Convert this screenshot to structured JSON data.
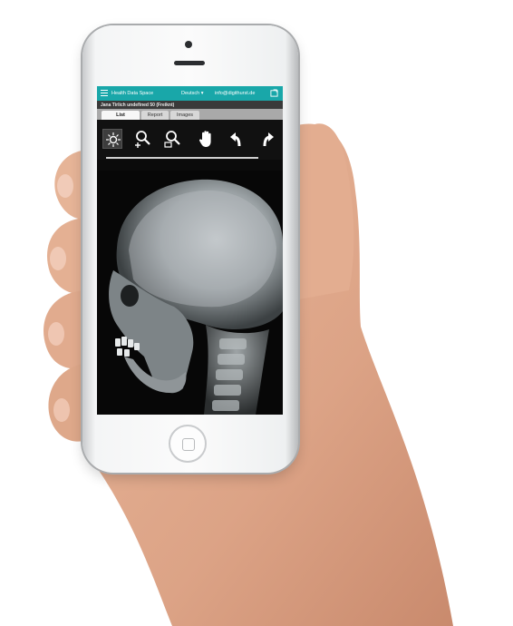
{
  "app": {
    "title": "Health Data Space",
    "language": "Deutsch",
    "language_caret": "▾",
    "user_email": "info@digithurst.de"
  },
  "patient": {
    "label": "Jana Tirlich undefined 50 (Freiknt)"
  },
  "tabs": [
    {
      "label": "List",
      "active": true
    },
    {
      "label": "Report",
      "active": false
    },
    {
      "label": "Images",
      "active": false
    }
  ],
  "toolbar": {
    "tools": [
      {
        "icon": "brightness-contrast-icon",
        "active": true
      },
      {
        "icon": "zoom-in-icon",
        "active": false
      },
      {
        "icon": "zoom-out-icon",
        "active": false
      },
      {
        "icon": "pan-hand-icon",
        "active": false
      },
      {
        "icon": "rotate-left-icon",
        "active": false
      },
      {
        "icon": "rotate-right-icon",
        "active": false
      }
    ]
  },
  "viewer": {
    "image_type": "lateral skull x-ray"
  },
  "colors": {
    "accent": "#19a7a9",
    "patient_bar": "#3a3a3a",
    "toolbar_bg": "#111111"
  }
}
